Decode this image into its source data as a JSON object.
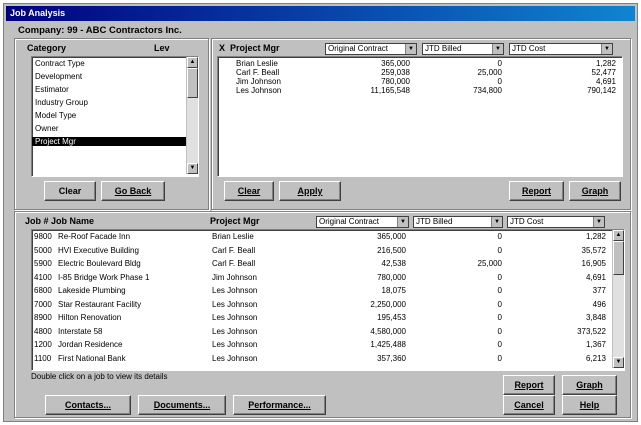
{
  "window": {
    "title": "Job Analysis"
  },
  "company_label": "Company: 99 - ABC Contractors Inc.",
  "category": {
    "header": "Category",
    "level_header": "Lev",
    "items": [
      "Contract Type",
      "Development",
      "Estimator",
      "Industry Group",
      "Model Type",
      "Owner",
      "Project Mgr"
    ],
    "selected": "Project Mgr",
    "clear_label": "Clear",
    "goback_label": "Go Back"
  },
  "summary": {
    "header_x": "X",
    "header_pm": "Project Mgr",
    "col1": "Original Contract",
    "col2": "JTD Billed",
    "col3": "JTD Cost",
    "rows": [
      {
        "name": "Brian Leslie",
        "contract": "365,000",
        "billed": "0",
        "cost": "1,282"
      },
      {
        "name": "Carl F. Beall",
        "contract": "259,038",
        "billed": "25,000",
        "cost": "52,477"
      },
      {
        "name": "Jim Johnson",
        "contract": "780,000",
        "billed": "0",
        "cost": "4,691"
      },
      {
        "name": "Les Johnson",
        "contract": "11,165,548",
        "billed": "734,800",
        "cost": "790,142"
      }
    ],
    "clear_label": "Clear",
    "apply_label": "Apply",
    "report_label": "Report",
    "graph_label": "Graph"
  },
  "jobs": {
    "header_job": "Job # Job Name",
    "header_pm": "Project Mgr",
    "col1": "Original Contract",
    "col2": "JTD Billed",
    "col3": "JTD Cost",
    "rows": [
      {
        "num": "9800",
        "name": "Re-Roof Facade Inn",
        "pm": "Brian Leslie",
        "contract": "365,000",
        "billed": "0",
        "cost": "1,282"
      },
      {
        "num": "5000",
        "name": "HVI Executive Building",
        "pm": "Carl F. Beall",
        "contract": "216,500",
        "billed": "0",
        "cost": "35,572"
      },
      {
        "num": "5900",
        "name": "Electric Boulevard Bldg",
        "pm": "Carl F. Beall",
        "contract": "42,538",
        "billed": "25,000",
        "cost": "16,905"
      },
      {
        "num": "4100",
        "name": "I-85 Bridge Work Phase 1",
        "pm": "Jim Johnson",
        "contract": "780,000",
        "billed": "0",
        "cost": "4,691"
      },
      {
        "num": "6800",
        "name": "Lakeside Plumbing",
        "pm": "Les Johnson",
        "contract": "18,075",
        "billed": "0",
        "cost": "377"
      },
      {
        "num": "7000",
        "name": "Star Restaurant Facility",
        "pm": "Les Johnson",
        "contract": "2,250,000",
        "billed": "0",
        "cost": "496"
      },
      {
        "num": "8900",
        "name": "Hilton Renovation",
        "pm": "Les Johnson",
        "contract": "195,453",
        "billed": "0",
        "cost": "3,848"
      },
      {
        "num": "4800",
        "name": "Interstate 58",
        "pm": "Les Johnson",
        "contract": "4,580,000",
        "billed": "0",
        "cost": "373,522"
      },
      {
        "num": "1200",
        "name": "Jordan Residence",
        "pm": "Les Johnson",
        "contract": "1,425,488",
        "billed": "0",
        "cost": "1,367"
      },
      {
        "num": "1100",
        "name": "First National Bank",
        "pm": "Les Johnson",
        "contract": "357,360",
        "billed": "0",
        "cost": "6,213"
      }
    ],
    "hint": "Double click on a job to view its details",
    "report_label": "Report",
    "graph_label": "Graph",
    "cancel_label": "Cancel",
    "help_label": "Help",
    "contacts_label": "Contacts...",
    "documents_label": "Documents...",
    "performance_label": "Performance..."
  }
}
